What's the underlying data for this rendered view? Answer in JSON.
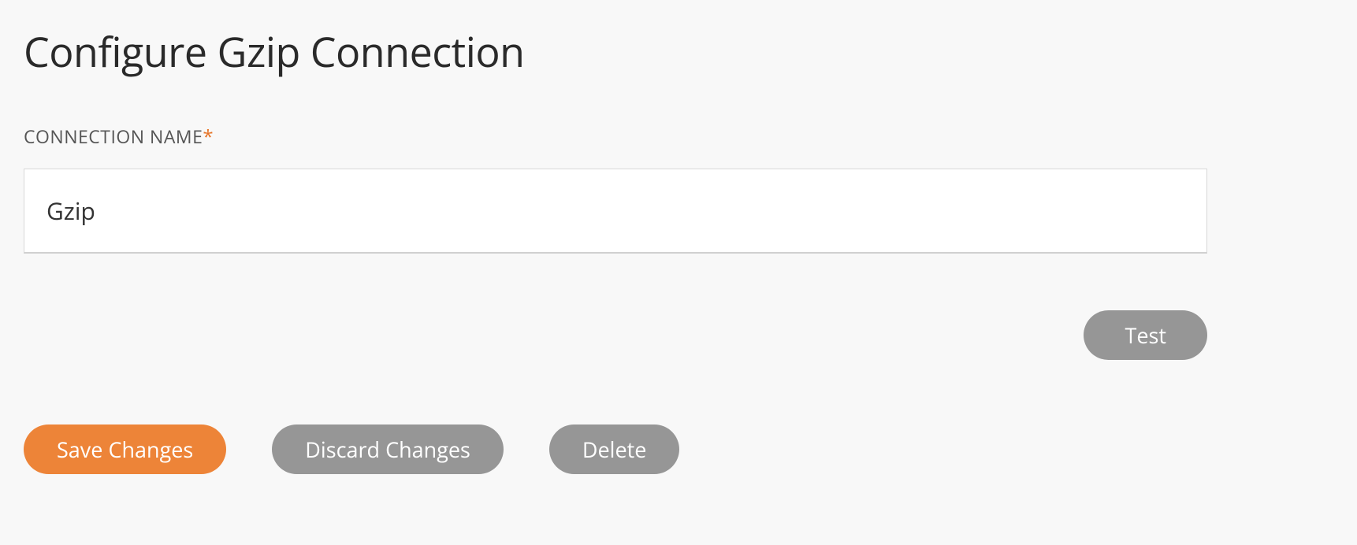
{
  "page": {
    "title": "Configure Gzip Connection"
  },
  "form": {
    "connection_name": {
      "label": "CONNECTION NAME",
      "required_marker": "*",
      "value": "Gzip"
    }
  },
  "buttons": {
    "test": "Test",
    "save": "Save Changes",
    "discard": "Discard Changes",
    "delete": "Delete"
  },
  "colors": {
    "accent": "#ed8438",
    "neutral_button": "#969696",
    "background": "#f8f8f8"
  }
}
